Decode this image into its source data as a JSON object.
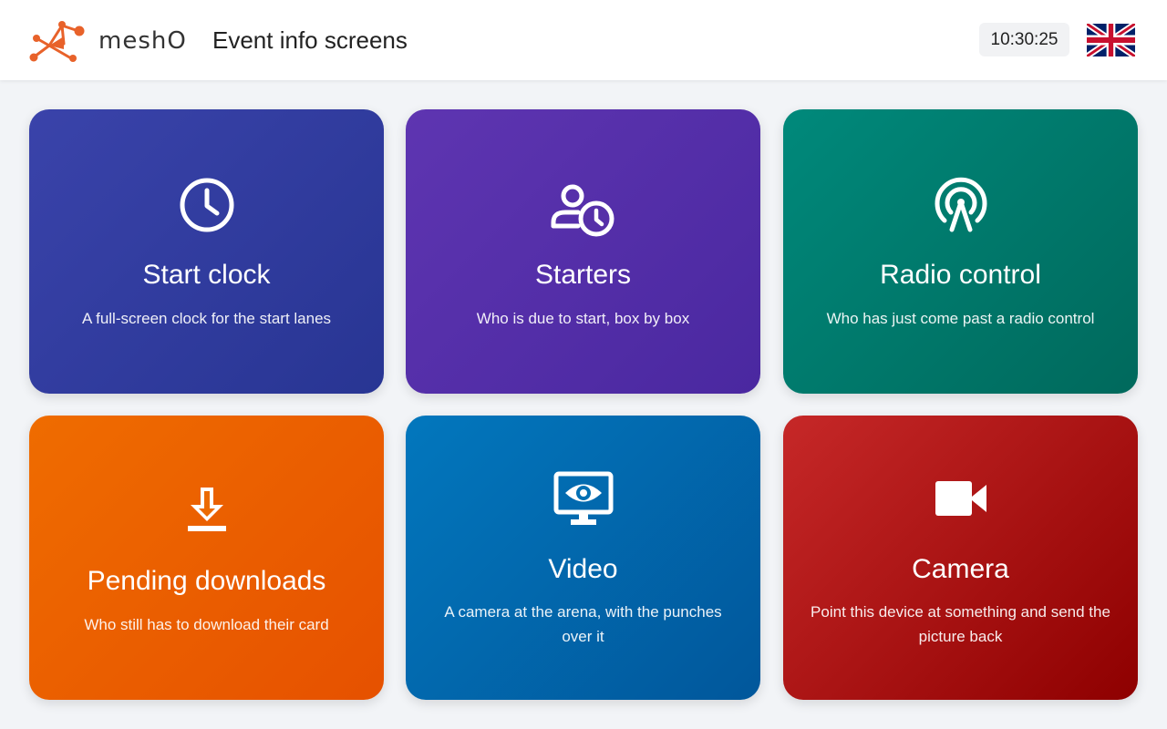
{
  "header": {
    "brand": "meshO",
    "title": "Event info screens",
    "clock": "10:30:25",
    "language_icon": "uk-flag-icon"
  },
  "colors": {
    "brand_orange": "#e8622a",
    "tile_start_clock": "#303f9f",
    "tile_starters": "#512da8",
    "tile_radio_control": "#00796b",
    "tile_pending_downloads": "#ef6c00",
    "tile_video": "#0277bd",
    "tile_camera": "#b71c1c"
  },
  "tiles": [
    {
      "title": "Start clock",
      "description": "A full-screen clock for the start lanes",
      "icon": "clock-icon"
    },
    {
      "title": "Starters",
      "description": "Who is due to start, box by box",
      "icon": "person-clock-icon"
    },
    {
      "title": "Radio control",
      "description": "Who has just come past a radio control",
      "icon": "radio-antenna-icon"
    },
    {
      "title": "Pending downloads",
      "description": "Who still has to download their card",
      "icon": "download-icon"
    },
    {
      "title": "Video",
      "description": "A camera at the arena, with the punches over it",
      "icon": "monitor-eye-icon"
    },
    {
      "title": "Camera",
      "description": "Point this device at something and send the picture back",
      "icon": "video-camera-icon"
    }
  ]
}
